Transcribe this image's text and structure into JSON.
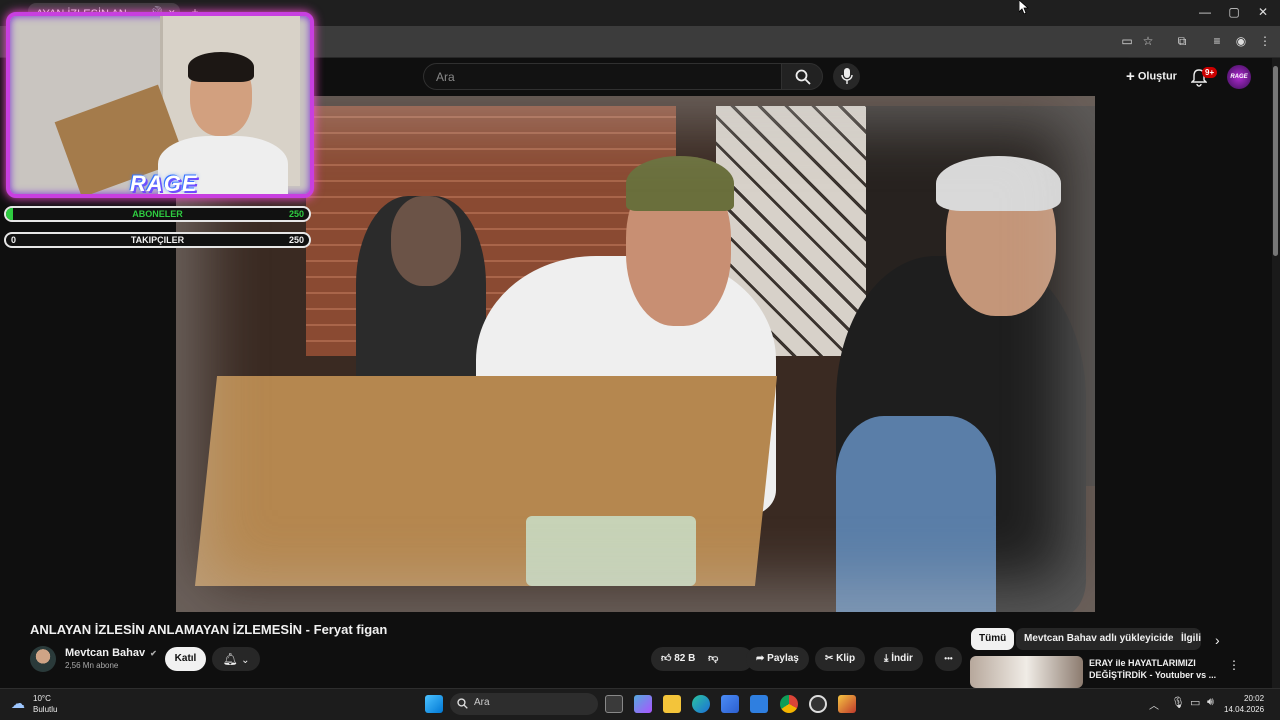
{
  "browser": {
    "tab_title": "AYAN İZLESİN AN",
    "tab_close": "✕",
    "new_tab": "+",
    "window_controls": [
      "—",
      "▢",
      "✕"
    ]
  },
  "header": {
    "search_placeholder": "Ara",
    "create_label": "Oluştur",
    "notification_count": "9+",
    "avatar_text": "RAGE"
  },
  "overlay": {
    "logo_text": "RAGE",
    "goals": [
      {
        "label": "ABONELER",
        "current": "",
        "target": "250",
        "color": "#2ecc40"
      },
      {
        "label": "TAKIPÇILER",
        "current": "0",
        "target": "250",
        "color": "#ffffff"
      }
    ]
  },
  "video": {
    "title": "ANLAYAN İZLESİN ANLAMAYAN İZLEMESİN - Feryat figan"
  },
  "channel": {
    "name": "Mevtcan Bahav",
    "verified": "✔",
    "subscribers": "2,56 Mn abone",
    "join_label": "Katıl"
  },
  "actions": {
    "likes": "82 B",
    "share": "Paylaş",
    "clip": "Klip",
    "download": "İndir",
    "more": "•••"
  },
  "chips": [
    "Tümü",
    "Mevtcan Bahav adlı yükleyiciden",
    "İlgili"
  ],
  "recommendation": {
    "title": "ERAY ile HAYATLARIMIZI DEĞİŞTİRDİK - Youtuber vs ..."
  },
  "taskbar": {
    "weather_temp": "10°C",
    "weather_desc": "Bulutlu",
    "search_label": "Ara",
    "time": "20:02",
    "date": "14.04.2026"
  }
}
